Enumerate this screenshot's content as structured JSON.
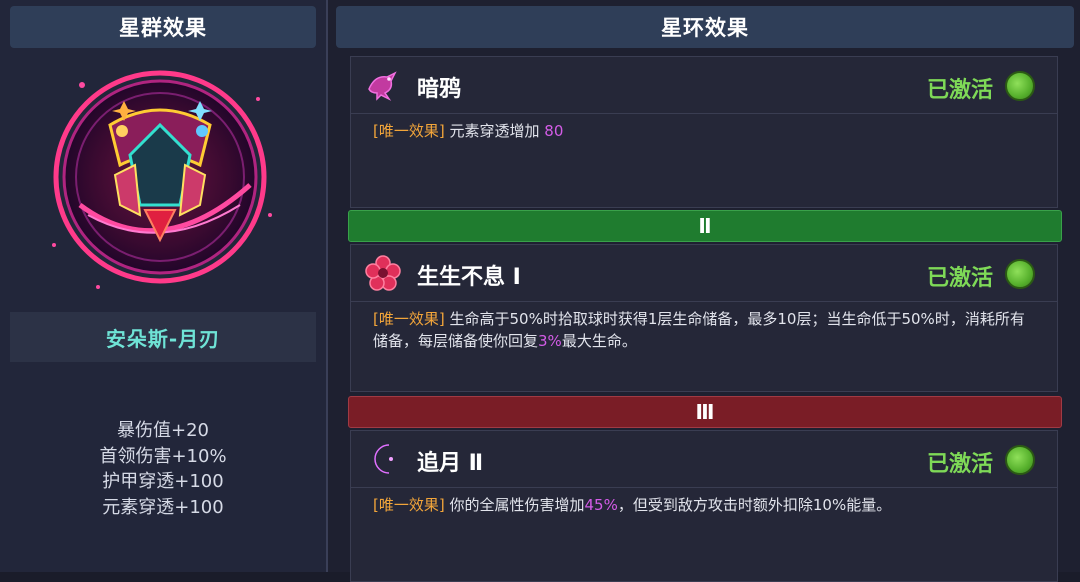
{
  "left": {
    "header": "星群效果",
    "name": "安朵斯-月刃",
    "stats": [
      "暴伤值+20",
      "首领伤害+10%",
      "护甲穿透+100",
      "元素穿透+100"
    ]
  },
  "right": {
    "header": "星环效果",
    "cards": [
      {
        "icon": "raven-icon",
        "title": "暗鸦",
        "status": "已激活",
        "tag": "[唯一效果]",
        "desc_parts": [
          "元素穿透增加 ",
          "80",
          ""
        ]
      },
      {
        "icon": "flower-icon",
        "title": "生生不息 Ⅰ",
        "status": "已激活",
        "tag": "[唯一效果]",
        "desc_parts": [
          "生命高于50%时拾取球时获得1层生命储备，最多10层；当生命低于50%时，消耗所有储备，每层储备使你回复",
          "3%",
          "最大生命。"
        ]
      },
      {
        "icon": "crescent-moon-icon",
        "title": "追月 Ⅱ",
        "status": "已激活",
        "tag": "[唯一效果]",
        "desc_parts": [
          "你的全属性伤害增加",
          "45%",
          "，但受到敌方攻击时额外扣除10%能量。"
        ]
      }
    ],
    "dividers": [
      "Ⅱ",
      "Ⅲ"
    ]
  },
  "colors": {
    "active_green": "#7ed957",
    "tag_orange": "#f2a53a",
    "highlight_purple": "#d35ce6",
    "name_teal": "#6fe3d6"
  }
}
